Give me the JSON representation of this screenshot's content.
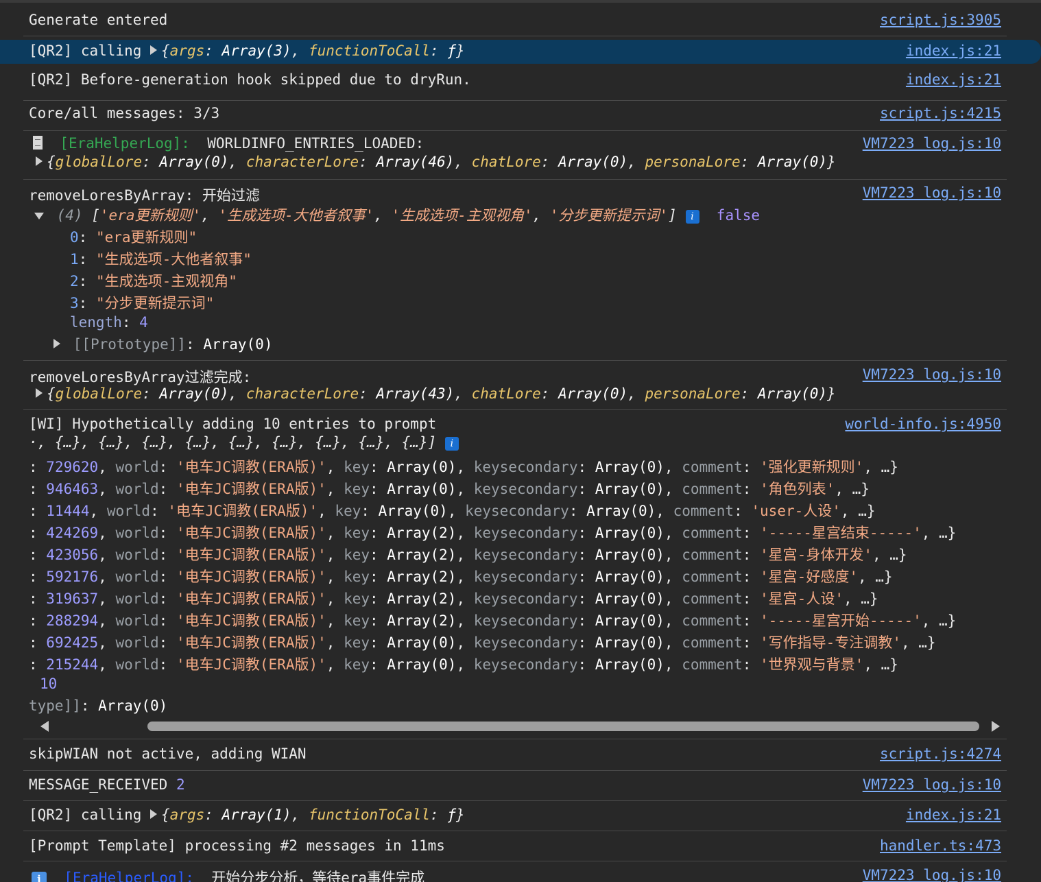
{
  "entries": {
    "e1": {
      "text": "Generate entered",
      "src": "script.js:3905"
    },
    "e2": {
      "prefix": "[QR2] calling ",
      "k1": "args",
      "v1": "Array(3)",
      "k2": "functionToCall",
      "v2": "ƒ",
      "src": "index.js:21"
    },
    "e3": {
      "text": "[QR2] Before-generation hook skipped due to dryRun.",
      "src": "index.js:21"
    },
    "e4": {
      "text": "Core/all messages: 3/3",
      "src": "script.js:4215"
    },
    "e5": {
      "tag": "[EraHelperLog]:",
      "label": "WORLDINFO_ENTRIES_LOADED:",
      "k1": "globalLore",
      "v1": "Array(0)",
      "k2": "characterLore",
      "v2": "Array(46)",
      "k3": "chatLore",
      "v3": "Array(0)",
      "k4": "personaLore",
      "v4": "Array(0)",
      "src": "VM7223 log.js:10"
    },
    "e6": {
      "label": "removeLoresByArray:  开始过滤",
      "count": "(4)",
      "preview": [
        "'era更新规则'",
        "'生成选项-大他者叙事'",
        "'生成选项-主观视角'",
        "'分步更新提示词'"
      ],
      "badge": "i",
      "extra": "false",
      "items": [
        {
          "i": "0",
          "v": "\"era更新规则\""
        },
        {
          "i": "1",
          "v": "\"生成选项-大他者叙事\""
        },
        {
          "i": "2",
          "v": "\"生成选项-主观视角\""
        },
        {
          "i": "3",
          "v": "\"分步更新提示词\""
        }
      ],
      "length_key": "length",
      "length_val": "4",
      "proto_key": "[[Prototype]]",
      "proto_val": "Array(0)",
      "src": "VM7223 log.js:10"
    },
    "e7": {
      "label": "removeLoresByArray过滤完成:",
      "k1": "globalLore",
      "v1": "Array(0)",
      "k2": "characterLore",
      "v2": "Array(43)",
      "k3": "chatLore",
      "v3": "Array(0)",
      "k4": "personaLore",
      "v4": "Array(0)",
      "src": "VM7223 log.js:10"
    },
    "e8": {
      "text": "[WI] Hypothetically adding 10 entries to prompt",
      "preview": "·, {…}, {…}, {…}, {…}, {…}, {…}, {…}, {…}, {…}]",
      "badge": "i",
      "rows": [
        {
          "uid": "729620",
          "world": "'电车JC调教(ERA版)'",
          "key": "Array(0)",
          "ks": "Array(0)",
          "comment": "'强化更新规则'"
        },
        {
          "uid": "946463",
          "world": "'电车JC调教(ERA版)'",
          "key": "Array(0)",
          "ks": "Array(0)",
          "comment": "'角色列表'"
        },
        {
          "uid": "11444",
          "world": "'电车JC调教(ERA版)'",
          "key": "Array(0)",
          "ks": "Array(0)",
          "comment": "'user-人设'"
        },
        {
          "uid": "424269",
          "world": "'电车JC调教(ERA版)'",
          "key": "Array(2)",
          "ks": "Array(0)",
          "comment": "'-----星宫结束-----'"
        },
        {
          "uid": "423056",
          "world": "'电车JC调教(ERA版)'",
          "key": "Array(2)",
          "ks": "Array(0)",
          "comment": "'星宫-身体开发'"
        },
        {
          "uid": "592176",
          "world": "'电车JC调教(ERA版)'",
          "key": "Array(2)",
          "ks": "Array(0)",
          "comment": "'星宫-好感度'"
        },
        {
          "uid": "319637",
          "world": "'电车JC调教(ERA版)'",
          "key": "Array(2)",
          "ks": "Array(0)",
          "comment": "'星宫-人设'"
        },
        {
          "uid": "288294",
          "world": "'电车JC调教(ERA版)'",
          "key": "Array(2)",
          "ks": "Array(0)",
          "comment": "'-----星宫开始-----'"
        },
        {
          "uid": "692425",
          "world": "'电车JC调教(ERA版)'",
          "key": "Array(0)",
          "ks": "Array(0)",
          "comment": "'写作指导-专注调教'"
        },
        {
          "uid": "215244",
          "world": "'电车JC调教(ERA版)'",
          "key": "Array(0)",
          "ks": "Array(0)",
          "comment": "'世界观与背景'"
        }
      ],
      "length_val": "10",
      "proto_tail": "type]]",
      "proto_val": "Array(0)",
      "src": "world-info.js:4950"
    },
    "e9": {
      "text": "skipWIAN not active, adding WIAN",
      "src": "script.js:4274"
    },
    "e10": {
      "text": "MESSAGE_RECEIVED",
      "num": "2",
      "src": "VM7223 log.js:10"
    },
    "e11": {
      "prefix": "[QR2] calling ",
      "k1": "args",
      "v1": "Array(1)",
      "k2": "functionToCall",
      "v2": "ƒ",
      "src": "index.js:21"
    },
    "e12": {
      "text": "[Prompt Template] processing #2 messages in 11ms",
      "src": "handler.ts:473"
    },
    "e13": {
      "icon": "i",
      "tag": "[EraHelperLog]:",
      "text": "开始分步分析，等待era事件完成",
      "src": "VM7223 log.js:10"
    }
  },
  "labels": {
    "world": "world",
    "key": "key",
    "ks": "keysecondary",
    "comment": "comment"
  },
  "colors": {
    "background": "#282828",
    "selected": "#0c3b5e",
    "link": "#7cacf8",
    "string": "#f2a984",
    "number": "#9d9cff",
    "key": "#e8c56a"
  }
}
